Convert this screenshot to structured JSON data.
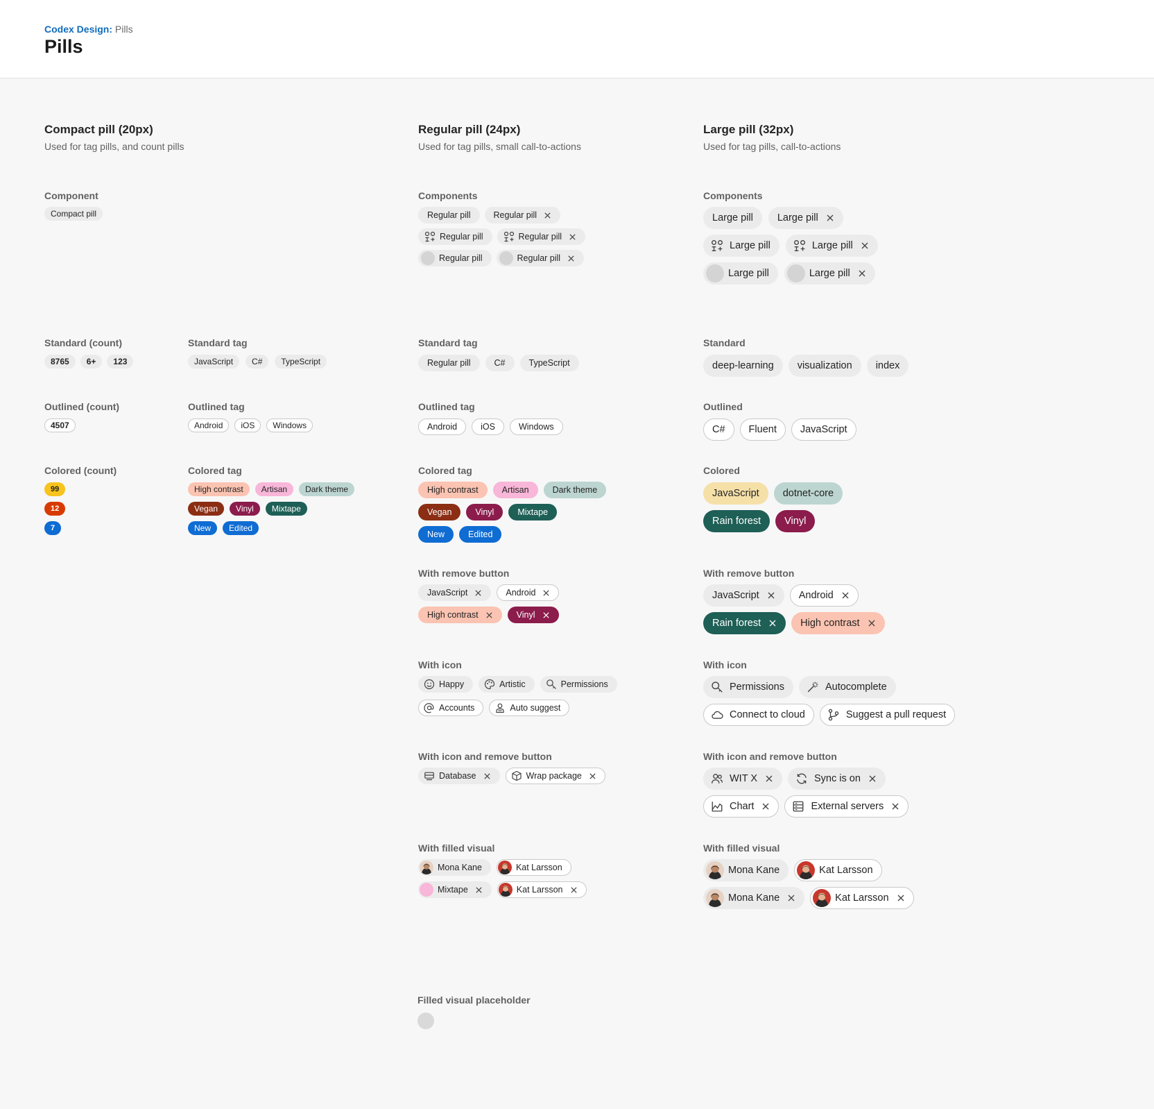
{
  "header": {
    "brand": "Codex Design:",
    "section": "Pills",
    "title": "Pills"
  },
  "colors": {
    "accent": "#0f6cbd",
    "peach": "#fbc3b1",
    "pink": "#f8b6d8",
    "sage": "#bcd5d0",
    "rust": "#8b2e14",
    "berry": "#8b1c4c",
    "teal": "#1e5f56",
    "blue": "#0f6cd3",
    "yellow": "#f7d36b",
    "orange": "#d83b01",
    "sand": "#f5e0a8"
  },
  "compact": {
    "title": "Compact pill (20px)",
    "subtitle": "Used for tag pills, and count pills",
    "component_label": "Component",
    "component_pill": "Compact pill",
    "standard_count_label": "Standard (count)",
    "standard_counts": [
      "8765",
      "6+",
      "123"
    ],
    "standard_tag_label": "Standard tag",
    "standard_tags": [
      "JavaScript",
      "C#",
      "TypeScript"
    ],
    "outlined_count_label": "Outlined (count)",
    "outlined_count": "4507",
    "outlined_tag_label": "Outlined tag",
    "outlined_tags": [
      "Android",
      "iOS",
      "Windows"
    ],
    "colored_count_label": "Colored (count)",
    "colored_counts": [
      "99",
      "12",
      "7"
    ],
    "colored_tag_label": "Colored tag",
    "colored_tags": [
      "High contrast",
      "Artisan",
      "Dark theme",
      "Vegan",
      "Vinyl",
      "Mixtape",
      "New",
      "Edited"
    ]
  },
  "regular": {
    "title": "Regular pill (24px)",
    "subtitle": "Used for tag pills, small call-to-actions",
    "components_label": "Components",
    "component_pill": "Regular pill",
    "standard_tag_label": "Standard tag",
    "standard_tags": [
      "Regular pill",
      "C#",
      "TypeScript"
    ],
    "outlined_tag_label": "Outlined tag",
    "outlined_tags": [
      "Android",
      "iOS",
      "Windows"
    ],
    "colored_tag_label": "Colored tag",
    "colored_tags": [
      "High contrast",
      "Artisan",
      "Dark theme",
      "Vegan",
      "Vinyl",
      "Mixtape",
      "New",
      "Edited"
    ],
    "remove_label": "With remove button",
    "remove_tags": [
      "JavaScript",
      "Android",
      "High contrast",
      "Vinyl"
    ],
    "icon_label": "With icon",
    "icon_tags": [
      {
        "label": "Happy",
        "icon": "emoji-icon"
      },
      {
        "label": "Artistic",
        "icon": "palette-icon"
      },
      {
        "label": "Permissions",
        "icon": "key-icon"
      },
      {
        "label": "Accounts",
        "icon": "at-icon"
      },
      {
        "label": "Auto suggest",
        "icon": "person-lines-icon"
      }
    ],
    "icon_remove_label": "With icon and remove button",
    "icon_remove_tags": [
      {
        "label": "Database",
        "icon": "database-icon"
      },
      {
        "label": "Wrap package",
        "icon": "box-icon"
      }
    ],
    "filled_label": "With filled visual",
    "filled_tags": [
      "Mona Kane",
      "Kat Larsson",
      "Mixtape",
      "Kat Larsson"
    ],
    "placeholder_label": "Filled visual placeholder"
  },
  "large": {
    "title": "Large pill (32px)",
    "subtitle": "Used for tag pills, call-to-actions",
    "components_label": "Components",
    "component_pill": "Large pill",
    "standard_label": "Standard",
    "standard_tags": [
      "deep-learning",
      "visualization",
      "index"
    ],
    "outlined_label": "Outlined",
    "outlined_tags": [
      "C#",
      "Fluent",
      "JavaScript"
    ],
    "colored_label": "Colored",
    "colored_tags": [
      "JavaScript",
      "dotnet-core",
      "Rain forest",
      "Vinyl"
    ],
    "remove_label": "With remove button",
    "remove_tags": [
      "JavaScript",
      "Android",
      "Rain forest",
      "High contrast"
    ],
    "icon_label": "With icon",
    "icon_tags": [
      {
        "label": "Permissions",
        "icon": "key-icon"
      },
      {
        "label": "Autocomplete",
        "icon": "wand-icon"
      },
      {
        "label": "Connect to cloud",
        "icon": "cloud-icon"
      },
      {
        "label": "Suggest a pull request",
        "icon": "branch-icon"
      }
    ],
    "icon_remove_label": "With icon and remove button",
    "icon_remove_tags": [
      {
        "label": "WIT X",
        "icon": "people-icon"
      },
      {
        "label": "Sync is on",
        "icon": "sync-icon"
      },
      {
        "label": "Chart",
        "icon": "chart-icon"
      },
      {
        "label": "External servers",
        "icon": "server-icon"
      }
    ],
    "filled_label": "With filled visual",
    "filled_tags": [
      "Mona Kane",
      "Kat Larsson",
      "Mona Kane",
      "Kat Larsson"
    ]
  }
}
